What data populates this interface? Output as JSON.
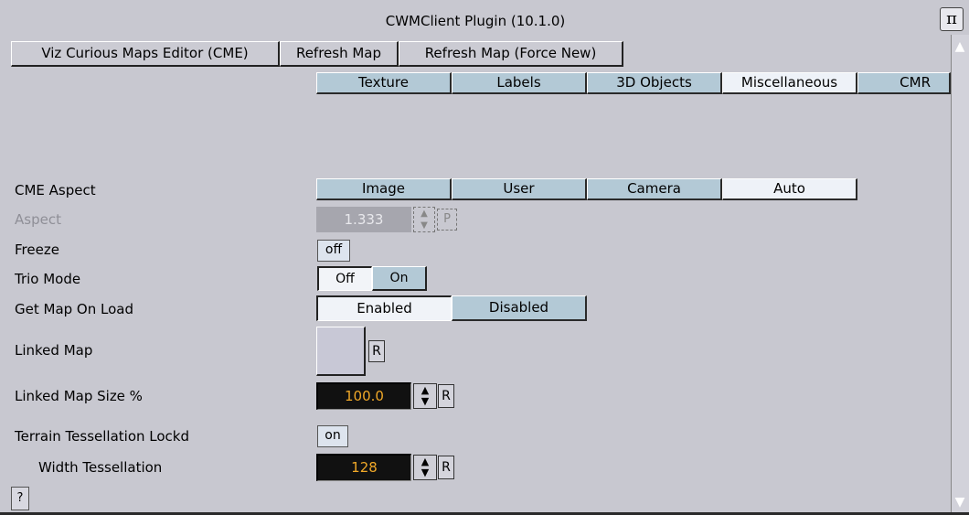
{
  "window": {
    "title": "CWMClient Plugin (10.1.0)"
  },
  "toolbar": {
    "cme_editor": "Viz Curious Maps Editor (CME)",
    "refresh_map": "Refresh Map",
    "refresh_force": "Refresh Map (Force New)"
  },
  "tabs": [
    "Texture",
    "Labels",
    "3D Objects",
    "Miscellaneous",
    "CMR"
  ],
  "active_tab": "Miscellaneous",
  "cme_aspect": {
    "label": "CME Aspect",
    "options": [
      "Image",
      "User",
      "Camera",
      "Auto"
    ],
    "selected": "Auto"
  },
  "aspect": {
    "label": "Aspect",
    "value": "1.333",
    "p_label": "P"
  },
  "freeze": {
    "label": "Freeze",
    "value": "off"
  },
  "trio_mode": {
    "label": "Trio Mode",
    "off": "Off",
    "on": "On"
  },
  "get_map_on_load": {
    "label": "Get Map On Load",
    "enabled": "Enabled",
    "disabled": "Disabled"
  },
  "linked_map": {
    "label": "Linked Map",
    "r": "R"
  },
  "linked_map_size": {
    "label": "Linked Map Size %",
    "value": "100.0",
    "r": "R"
  },
  "terrain_lock": {
    "label": "Terrain Tessellation Lockd",
    "value": "on"
  },
  "width_tessellation": {
    "label": "Width Tessellation",
    "value": "128",
    "r": "R"
  },
  "help": {
    "label": "?"
  }
}
